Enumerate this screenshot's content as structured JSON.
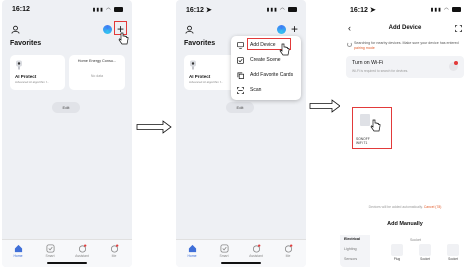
{
  "screen1": {
    "status_time": "16:12",
    "favorites_title": "Favorites",
    "cards": [
      {
        "name": "AI Protect",
        "sub": "Advanced AI algorithm f..."
      },
      {
        "name": "Home Energy Consu...",
        "value": "No data"
      }
    ],
    "edit_label": "Edit",
    "tabs": [
      "Home",
      "Smart",
      "Assistant",
      "Me"
    ]
  },
  "screen2": {
    "status_time": "16:12 ➤",
    "favorites_title": "Favorites",
    "cards": [
      {
        "name": "AI Protect",
        "sub": "Advanced AI algorithm f..."
      }
    ],
    "edit_label": "Edit",
    "menu_items": [
      "Add Device",
      "Create Scene",
      "Add Favorite Cards",
      "Scan"
    ],
    "tabs": [
      "Home",
      "Smart",
      "Assistant",
      "Me"
    ]
  },
  "screen3": {
    "status_time": "16:12 ➤",
    "title": "Add Device",
    "searching_text": "Searching for nearby devices. Make sure your device has entered",
    "pairing_link": "pairing mode",
    "wifi_title": "Turn on Wi-Fi",
    "wifi_sub": "Wi-Fi is required to search for devices.",
    "device_found_name": "SONOFF",
    "device_found_sub": "WiFi T1",
    "auto_note": "Devices will be added automatically.",
    "auto_cancel": "Cancel (78)",
    "add_manually": "Add Manually",
    "categories": [
      "Electrical",
      "Lighting",
      "Sensors",
      "Large"
    ],
    "group_title": "Socket",
    "products": [
      {
        "name": "Plug",
        "sub": "(BLE+Wi-Fi)"
      },
      {
        "name": "Socket",
        "sub": "(Wi-Fi)"
      },
      {
        "name": "Socket",
        "sub": "(Zigbee)"
      }
    ]
  },
  "colors": {
    "accent_red": "#e23a3a",
    "tab_active": "#3f6fd8",
    "link": "#e25b2a"
  }
}
